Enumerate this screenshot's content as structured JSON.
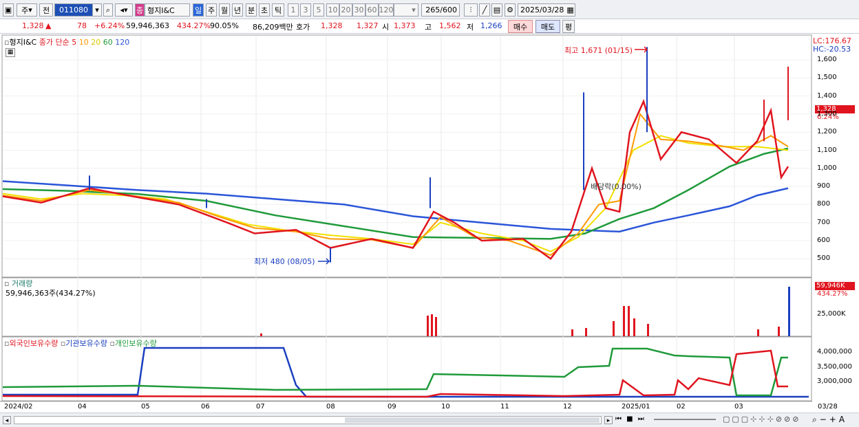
{
  "toolbar": {
    "mode": "주",
    "prev": "전",
    "code": "011080",
    "company": "형지I&C",
    "badge": "종",
    "periods": [
      "일",
      "주",
      "월",
      "년",
      "분",
      "초",
      "틱"
    ],
    "minutes": [
      "1",
      "3",
      "5",
      "10",
      "20",
      "30",
      "60",
      "120"
    ],
    "count": "265",
    "count_max": "/600",
    "date": "2025/03/28"
  },
  "quote": {
    "price": "1,328",
    "arrow": "▲",
    "change": "78",
    "pct": "+6.24%",
    "volume": "59,946,363",
    "vol_pct": "434.27%",
    "vol_ratio": "90.05%",
    "amount": "86,209백만",
    "bid_label": "호가",
    "bid1": "1,328",
    "bid2": "1,327",
    "open_label": "시",
    "open": "1,373",
    "high_label": "고",
    "high": "1,562",
    "low_label": "저",
    "low": "1,266",
    "buy": "매수",
    "sell": "매도",
    "avg": "평"
  },
  "price_panel": {
    "name": "형지I&C",
    "ma_label": "종가 단순",
    "ma5": "5",
    "ma10": "10",
    "ma20": "20",
    "ma60": "60",
    "ma120": "120",
    "lc": "LC:176.67",
    "hc": "HC:-20.53",
    "cur_price": "1,328",
    "cur_pct": "6.24%",
    "high_note": "최고 1,671 (01/15)",
    "low_note": "최저 480 (08/05)",
    "ex_note": "배당락(0.00%)",
    "yticks": [
      "1,600",
      "1,500",
      "1,400",
      "1,300",
      "1,200",
      "1,100",
      "1,000",
      "900",
      "800",
      "700",
      "600",
      "500"
    ]
  },
  "vol_panel": {
    "title": "거래량",
    "value": "59,946,363주(434.27%)",
    "badge_value": "59,946K",
    "badge_pct": "434.27%",
    "ytick": "25,000K"
  },
  "hold_panel": {
    "foreign": "외국인보유수량",
    "inst": "기관보유수량",
    "indiv": "개인보유수량",
    "yticks": [
      "4,000,000",
      "3,500,000",
      "3,000,000"
    ]
  },
  "xaxis": [
    "2024/02",
    "04",
    "05",
    "06",
    "07",
    "08",
    "09",
    "10",
    "11",
    "12",
    "2025/01",
    "02",
    "03",
    "03/28"
  ],
  "colors": {
    "up": "#e0141e",
    "down": "#1a3fbf",
    "ma5": "#e0141e",
    "ma10": "#ff9a00",
    "ma20": "#f0e000",
    "ma60": "#1f9a3a",
    "ma120": "#2a55d8"
  }
}
